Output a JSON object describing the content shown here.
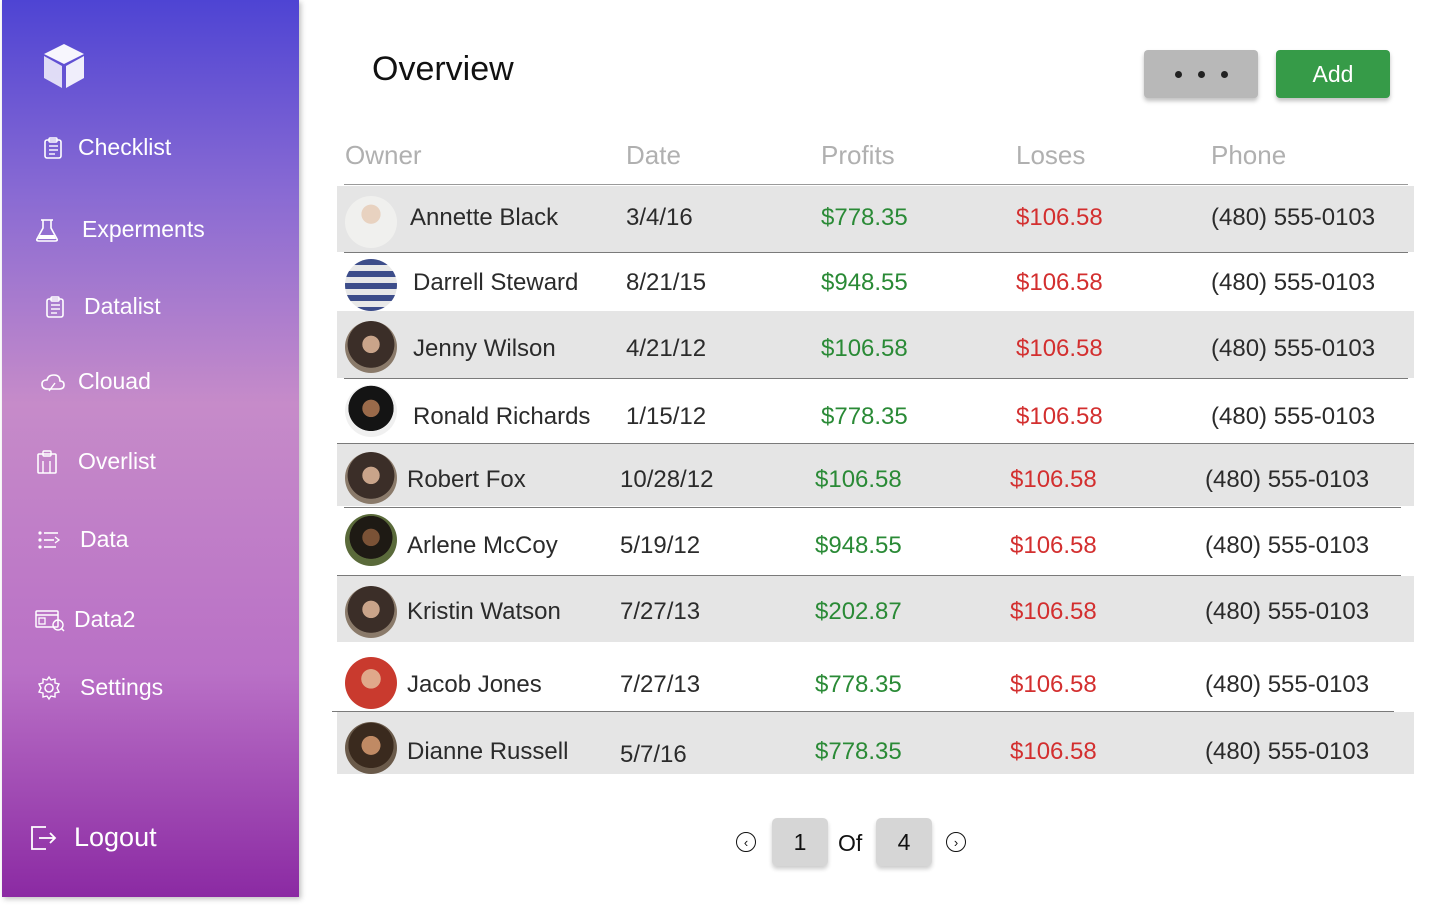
{
  "sidebar": {
    "items": [
      {
        "label": "Checklist",
        "icon": "clipboard-list-icon"
      },
      {
        "label": "Experments",
        "icon": "flask-icon"
      },
      {
        "label": "Datalist",
        "icon": "clipboard-list-icon"
      },
      {
        "label": "Clouad",
        "icon": "cloud-icon"
      },
      {
        "label": "Overlist",
        "icon": "clipboard-icon"
      },
      {
        "label": "Data",
        "icon": "list-icon"
      },
      {
        "label": "Data2",
        "icon": "dashboard-icon"
      },
      {
        "label": "Settings",
        "icon": "gear-icon"
      }
    ],
    "logout_label": "Logout"
  },
  "header": {
    "title": "Overview",
    "add_label": "Add",
    "more_icon": "more-dots-icon"
  },
  "table": {
    "columns": [
      "Owner",
      "Date",
      "Profits",
      "Loses",
      "Phone"
    ],
    "rows": [
      {
        "owner": "Annette Black",
        "date": "3/4/16",
        "profit": "$778.35",
        "loss": "$106.58",
        "phone": "(480) 555-0103"
      },
      {
        "owner": "Darrell Steward",
        "date": "8/21/15",
        "profit": "$948.55",
        "loss": "$106.58",
        "phone": "(480) 555-0103"
      },
      {
        "owner": "Jenny Wilson",
        "date": "4/21/12",
        "profit": "$106.58",
        "loss": "$106.58",
        "phone": "(480) 555-0103"
      },
      {
        "owner": "Ronald Richards",
        "date": "1/15/12",
        "profit": "$778.35",
        "loss": "$106.58",
        "phone": "(480) 555-0103"
      },
      {
        "owner": "Robert Fox",
        "date": "10/28/12",
        "profit": "$106.58",
        "loss": "$106.58",
        "phone": "(480) 555-0103"
      },
      {
        "owner": "Arlene McCoy",
        "date": "5/19/12",
        "profit": "$948.55",
        "loss": "$106.58",
        "phone": "(480) 555-0103"
      },
      {
        "owner": "Kristin Watson",
        "date": "7/27/13",
        "profit": "$202.87",
        "loss": "$106.58",
        "phone": "(480) 555-0103"
      },
      {
        "owner": "Jacob Jones",
        "date": "7/27/13",
        "profit": "$778.35",
        "loss": "$106.58",
        "phone": "(480) 555-0103"
      },
      {
        "owner": "Dianne Russell",
        "date": "5/7/16",
        "profit": "$778.35",
        "loss": "$106.58",
        "phone": "(480) 555-0103"
      }
    ]
  },
  "pagination": {
    "current": "1",
    "of_label": "Of",
    "total": "4"
  },
  "colors": {
    "profit": "#2a8a36",
    "loss": "#d32f2f",
    "add_button": "#369b48"
  }
}
